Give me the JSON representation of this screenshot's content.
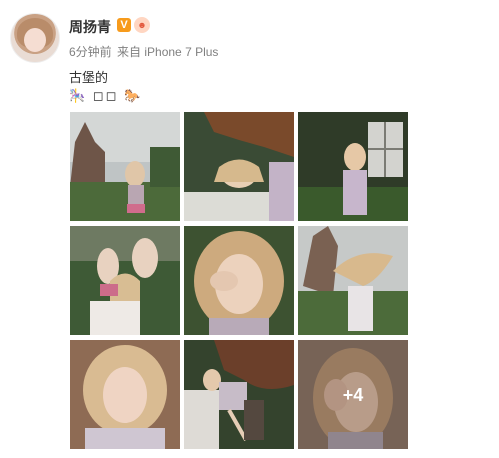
{
  "user": {
    "name": "周扬青",
    "v_badge": "V"
  },
  "meta": {
    "time": "6分钟前",
    "source": "来自 iPhone 7 Plus"
  },
  "post": {
    "text": "古堡的",
    "emoji_line": "🎠 ◻◻ 🐎"
  },
  "photos": [
    {
      "alt": "castle-garden-photo"
    },
    {
      "alt": "horse-table-photo"
    },
    {
      "alt": "window-garden-photo"
    },
    {
      "alt": "hands-raised-photo"
    },
    {
      "alt": "face-hand-photo"
    },
    {
      "alt": "hair-flip-photo"
    },
    {
      "alt": "closeup-portrait-photo"
    },
    {
      "alt": "horse-chair-photo"
    },
    {
      "alt": "hand-face-photo"
    }
  ],
  "more_count": "+4",
  "colors": {
    "vip": "#f79b1c",
    "meta_text": "#808080"
  }
}
